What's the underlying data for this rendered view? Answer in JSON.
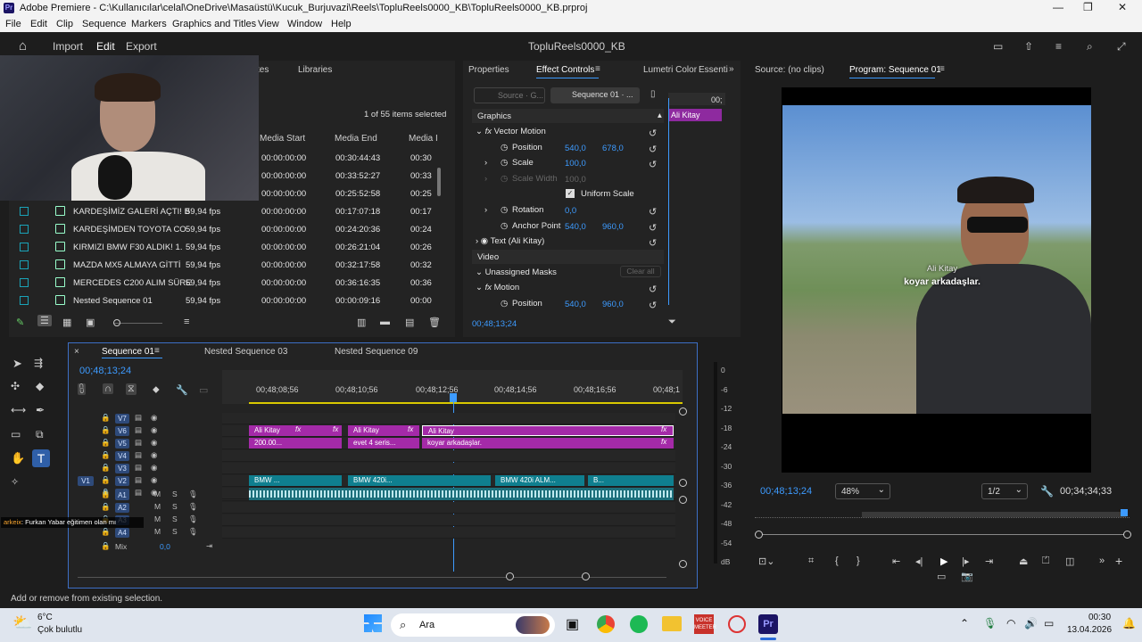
{
  "window": {
    "title": "Adobe Premiere - C:\\Kullanıcılar\\celal\\OneDrive\\Masaüstü\\Kucuk_Burjuvazi\\Reels\\TopluReels0000_KB\\TopluReels0000_KB.prproj",
    "logo": "Pr"
  },
  "menu": [
    "File",
    "Edit",
    "Clip",
    "Sequence",
    "Markers",
    "Graphics and Titles",
    "View",
    "Window",
    "Help"
  ],
  "workspace": {
    "import": "Import",
    "edit": "Edit",
    "export": "Export",
    "project_name": "TopluReels0000_KB"
  },
  "project": {
    "tabs": [
      "tes",
      "Libraries"
    ],
    "selection_status": "1 of 55 items selected",
    "columns": [
      "Media Start",
      "Media End",
      "Media I"
    ],
    "rows": [
      {
        "name": "",
        "fps": "",
        "start": "00:00:00:00",
        "end": "00:30:44:43",
        "dur": "00:30"
      },
      {
        "name": "",
        "fps": "",
        "start": "00:00:00:00",
        "end": "00:33:52:27",
        "dur": "00:33"
      },
      {
        "name": "",
        "fps": "",
        "start": "00:00:00:00",
        "end": "00:25:52:58",
        "dur": "00:25"
      },
      {
        "name": "KARDEŞİMİZ GALERİ AÇTI! B",
        "fps": "59,94 fps",
        "start": "00:00:00:00",
        "end": "00:17:07:18",
        "dur": "00:17"
      },
      {
        "name": "KARDEŞİMDEN TOYOTA CO",
        "fps": "59,94 fps",
        "start": "00:00:00:00",
        "end": "00:24:20:36",
        "dur": "00:24"
      },
      {
        "name": "KIRMIZI BMW F30 ALDIK! 1.",
        "fps": "59,94 fps",
        "start": "00:00:00:00",
        "end": "00:26:21:04",
        "dur": "00:26"
      },
      {
        "name": "MAZDA MX5 ALMAYA GİTTİ",
        "fps": "59,94 fps",
        "start": "00:00:00:00",
        "end": "00:32:17:58",
        "dur": "00:32"
      },
      {
        "name": "MERCEDES C200 ALIM SÜRE",
        "fps": "59,94 fps",
        "start": "00:00:00:00",
        "end": "00:36:16:35",
        "dur": "00:36"
      },
      {
        "name": "Nested Sequence 01",
        "fps": "59,94 fps",
        "start": "00:00:00:00",
        "end": "00:00:09:16",
        "dur": "00:00"
      }
    ]
  },
  "effect_controls": {
    "tabs": [
      "Properties",
      "Effect Controls",
      "Lumetri Color",
      "Essenti"
    ],
    "source_btn": "Source · G...",
    "sequence_btn": "Sequence 01 · ...",
    "ruler_time": "00;",
    "clip_label": "Ali Kitay",
    "section_graphics": "Graphics",
    "vector_motion": "Vector Motion",
    "position_label": "Position",
    "position_x": "540,0",
    "position_y": "678,0",
    "scale_label": "Scale",
    "scale_value": "100,0",
    "scale_width_label": "Scale Width",
    "scale_width_value": "100,0",
    "uniform_scale": "Uniform Scale",
    "rotation_label": "Rotation",
    "rotation_value": "0,0",
    "anchor_label": "Anchor Point",
    "anchor_x": "540,0",
    "anchor_y": "960,0",
    "text_layer": "Text (Ali Kitay)",
    "section_video": "Video",
    "unassigned_masks": "Unassigned Masks",
    "clear_all": "Clear all",
    "motion": "Motion",
    "motion_position_label": "Position",
    "motion_position_x": "540,0",
    "motion_position_y": "960,0",
    "timecode": "00;48;13;24"
  },
  "source_monitor": {
    "label": "Source: (no clips)"
  },
  "program_monitor": {
    "label": "Program: Sequence 01",
    "subtitle_line1": "Ali Kitay",
    "subtitle_line2": "koyar arkadaşlar.",
    "timecode": "00;48;13;24",
    "zoom": "48%",
    "resolution": "1/2",
    "duration": "00;34;34;33"
  },
  "timeline": {
    "tabs": [
      "Sequence 01",
      "Nested Sequence 03",
      "Nested Sequence 09"
    ],
    "timecode": "00;48;13;24",
    "ruler": [
      "00;48;08;56",
      "00;48;10;56",
      "00;48;12;56",
      "00;48;14;56",
      "00;48;16;56",
      "00;48;1"
    ],
    "video_tracks": [
      "V7",
      "V6",
      "V5",
      "V4",
      "V3",
      "V2",
      "V1"
    ],
    "audio_tracks": [
      "A1",
      "A2",
      "A3",
      "A4"
    ],
    "source_patch": "V1",
    "mix_label": "Mix",
    "mix_value": "0,0",
    "clips_v5": [
      "Ali Kitay",
      "Ali Kitay",
      "Ali Kitay"
    ],
    "clips_v4": [
      "200.00...",
      "evet 4 seris...",
      "koyar arkadaşlar."
    ],
    "clips_v1": [
      "BMW ...",
      "BMW 420i...",
      "BMW 420i ALM...",
      "B..."
    ],
    "fx": "fx",
    "meter_labels": [
      "0",
      "-6",
      "-12",
      "-18",
      "-24",
      "-30",
      "-36",
      "-42",
      "-48",
      "-54",
      "dB"
    ],
    "chat_overlay": {
      "user": "arkeix",
      "message": ": Furkan Yabar eğitimen olan mı"
    }
  },
  "status": {
    "hint": "Add or remove from existing selection."
  },
  "taskbar": {
    "temp": "6°C",
    "weather": "Çok bulutlu",
    "search": "Ara",
    "time": "00:30",
    "date": "13.04.2026"
  }
}
